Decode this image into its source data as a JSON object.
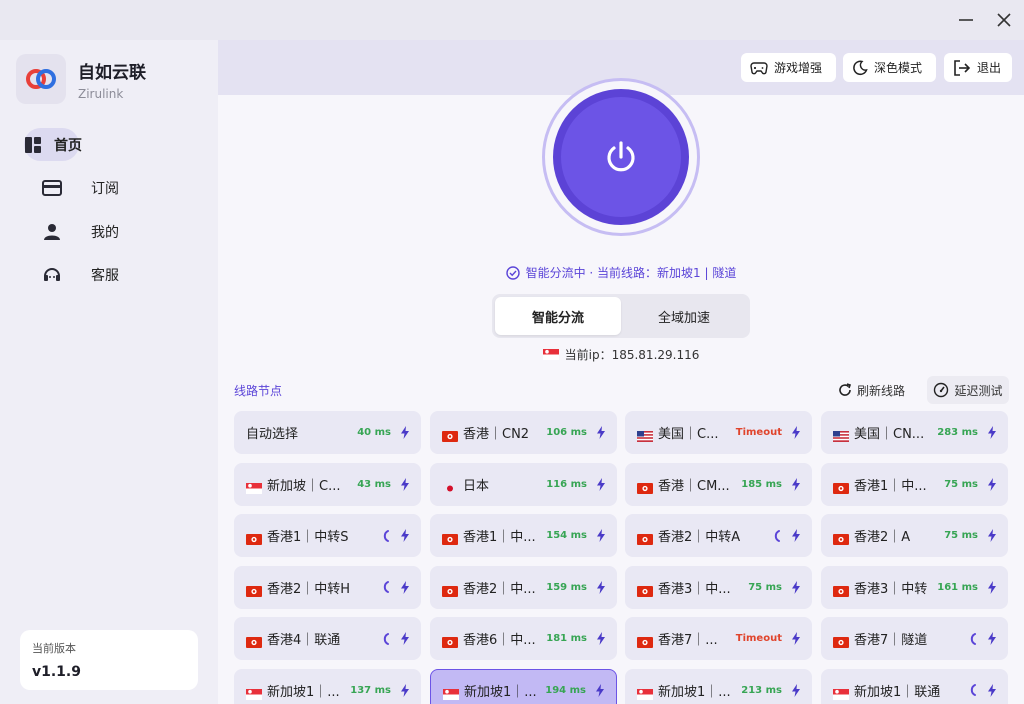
{
  "window": {
    "min_glyph": "—",
    "close_glyph": "✕"
  },
  "brand": {
    "name": "自如云联",
    "subtitle": "Zirulink"
  },
  "nav": [
    {
      "label": "首页",
      "icon": "dashboard-icon",
      "active": true
    },
    {
      "label": "订阅",
      "icon": "card-icon",
      "active": false
    },
    {
      "label": "我的",
      "icon": "user-icon",
      "active": false
    },
    {
      "label": "客服",
      "icon": "headset-icon",
      "active": false
    }
  ],
  "version": {
    "title": "当前版本",
    "value": "v1.1.9"
  },
  "toolbar": {
    "game_label": "游戏增强",
    "dark_label": "深色模式",
    "exit_label": "退出"
  },
  "status": {
    "text": "智能分流中 · 当前线路：新加坡1 | 隧道"
  },
  "mode": {
    "options": [
      "智能分流",
      "全域加速"
    ],
    "selected": "智能分流"
  },
  "ip": {
    "text": "当前ip：185.81.29.116"
  },
  "nodes_section": {
    "title": "线路节点",
    "refresh_label": "刷新线路",
    "latency_label": "延迟测试"
  },
  "colors": {
    "accent": "#6c54e6",
    "ok": "#37a554",
    "timeout": "#e0442c"
  },
  "nodes": [
    {
      "name": "自动选择",
      "flag": "",
      "latency": "40 ms",
      "status": "ok"
    },
    {
      "name": "香港｜CN2",
      "flag": "hk",
      "latency": "106 ms",
      "status": "ok"
    },
    {
      "name": "美国｜C...",
      "flag": "us",
      "latency": "Timeout",
      "status": "timeout"
    },
    {
      "name": "美国｜CN...",
      "flag": "us",
      "latency": "283 ms",
      "status": "ok"
    },
    {
      "name": "新加坡｜C...",
      "flag": "sg",
      "latency": "43 ms",
      "status": "ok"
    },
    {
      "name": "日本",
      "flag": "jp",
      "latency": "116 ms",
      "status": "ok"
    },
    {
      "name": "香港｜CM...",
      "flag": "hk",
      "latency": "185 ms",
      "status": "ok"
    },
    {
      "name": "香港1｜中...",
      "flag": "hk",
      "latency": "75 ms",
      "status": "ok"
    },
    {
      "name": "香港1｜中转S",
      "flag": "hk",
      "latency": "",
      "status": "testing"
    },
    {
      "name": "香港1｜中...",
      "flag": "hk",
      "latency": "154 ms",
      "status": "ok"
    },
    {
      "name": "香港2｜中转A",
      "flag": "hk",
      "latency": "",
      "status": "testing"
    },
    {
      "name": "香港2｜A",
      "flag": "hk",
      "latency": "75 ms",
      "status": "ok"
    },
    {
      "name": "香港2｜中转H",
      "flag": "hk",
      "latency": "",
      "status": "testing"
    },
    {
      "name": "香港2｜中...",
      "flag": "hk",
      "latency": "159 ms",
      "status": "ok"
    },
    {
      "name": "香港3｜中...",
      "flag": "hk",
      "latency": "75 ms",
      "status": "ok"
    },
    {
      "name": "香港3｜中转",
      "flag": "hk",
      "latency": "161 ms",
      "status": "ok"
    },
    {
      "name": "香港4｜联通",
      "flag": "hk",
      "latency": "",
      "status": "testing"
    },
    {
      "name": "香港6｜中...",
      "flag": "hk",
      "latency": "181 ms",
      "status": "ok"
    },
    {
      "name": "香港7｜...",
      "flag": "hk",
      "latency": "Timeout",
      "status": "timeout"
    },
    {
      "name": "香港7｜隧道",
      "flag": "hk",
      "latency": "",
      "status": "testing"
    },
    {
      "name": "新加坡1｜...",
      "flag": "sg",
      "latency": "137 ms",
      "status": "ok"
    },
    {
      "name": "新加坡1｜...",
      "flag": "sg",
      "latency": "194 ms",
      "status": "ok",
      "selected": true
    },
    {
      "name": "新加坡1｜...",
      "flag": "sg",
      "latency": "213 ms",
      "status": "ok"
    },
    {
      "name": "新加坡1｜联通",
      "flag": "sg",
      "latency": "",
      "status": "testing"
    }
  ]
}
